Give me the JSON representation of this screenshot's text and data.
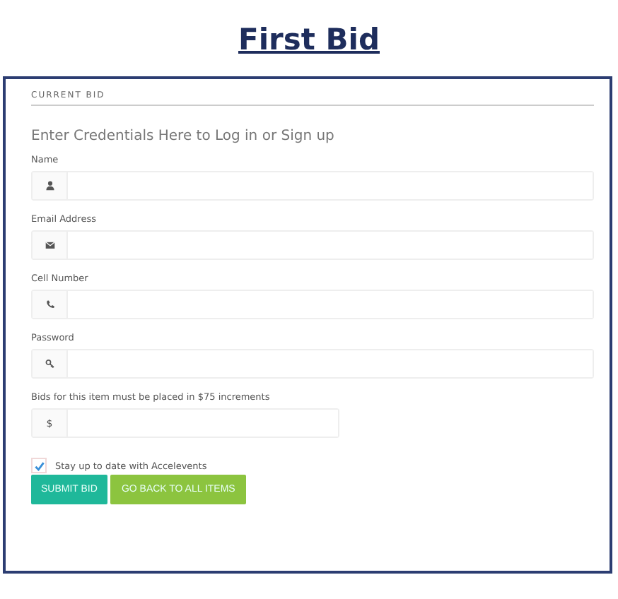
{
  "title": "First Bid",
  "panel": {
    "heading": "CURRENT BID",
    "intro": "Enter Credentials Here to Log in or Sign up",
    "fields": [
      {
        "label": "Name",
        "kind": "person"
      },
      {
        "label": "Email Address",
        "kind": "email"
      },
      {
        "label": "Cell Number",
        "kind": "phone"
      },
      {
        "label": "Password",
        "kind": "password"
      }
    ],
    "bid": {
      "label": "Bids for this item must be placed in $75 increments",
      "prefix": "$"
    },
    "subscribe": {
      "label": "Stay up to date with Accelevents",
      "checked": true
    },
    "buttons": [
      {
        "label": "SUBMIT BID",
        "kind": "primary"
      },
      {
        "label": "GO BACK TO ALL ITEMS",
        "kind": "secondary"
      }
    ]
  }
}
